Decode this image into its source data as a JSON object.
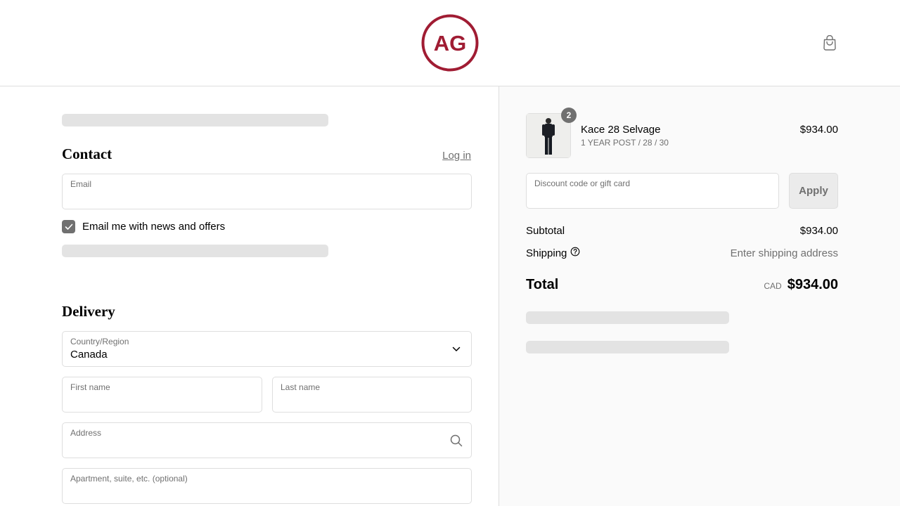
{
  "brand": {
    "logo_text": "AG",
    "logo_color": "#a01c33"
  },
  "header": {
    "cart_icon": "shopping-bag-icon"
  },
  "contact": {
    "title": "Contact",
    "login_label": "Log in",
    "email_label": "Email",
    "email_value": "",
    "newsletter_label": "Email me with news and offers",
    "newsletter_checked": true
  },
  "delivery": {
    "title": "Delivery",
    "country_label": "Country/Region",
    "country_value": "Canada",
    "first_name_label": "First name",
    "last_name_label": "Last name",
    "address_label": "Address",
    "apartment_label": "Apartment, suite, etc. (optional)"
  },
  "summary": {
    "item": {
      "name": "Kace 28 Selvage",
      "variant": "1 YEAR POST / 28 / 30",
      "quantity": "2",
      "price": "$934.00"
    },
    "discount_label": "Discount code or gift card",
    "apply_label": "Apply",
    "subtotal_label": "Subtotal",
    "subtotal_value": "$934.00",
    "shipping_label": "Shipping",
    "shipping_value": "Enter shipping address",
    "total_label": "Total",
    "total_currency": "CAD",
    "total_value": "$934.00"
  }
}
